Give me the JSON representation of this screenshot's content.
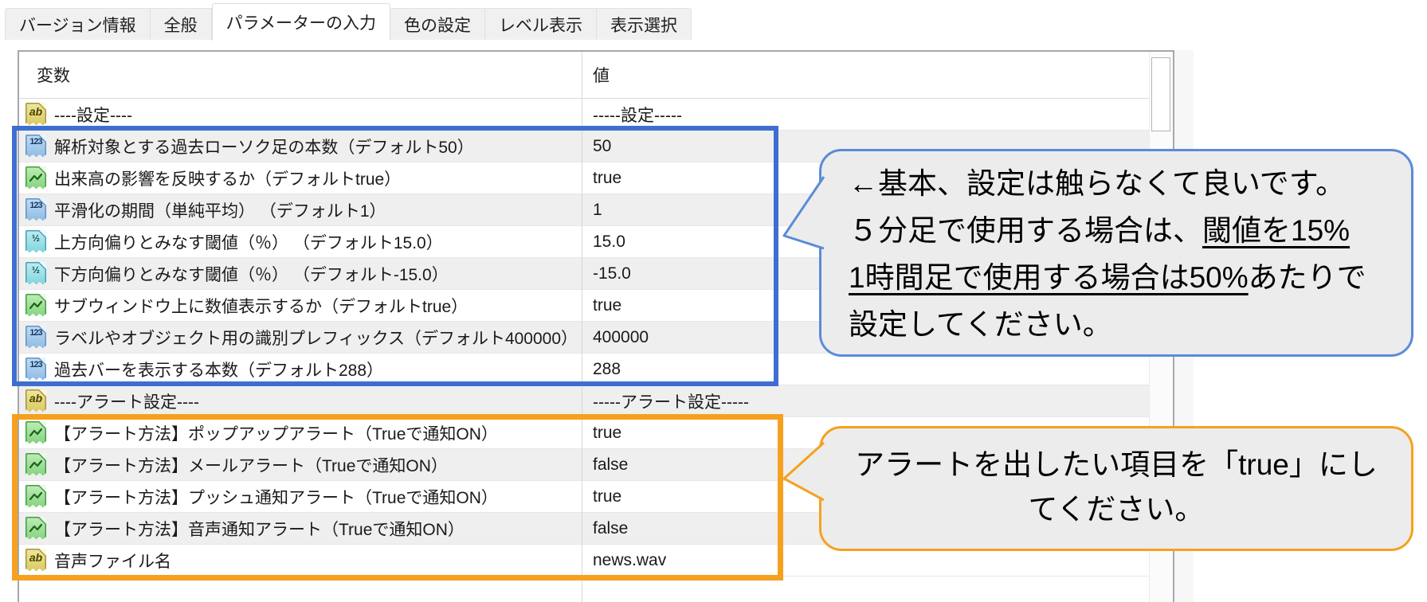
{
  "colors": {
    "blue_box": "#3e6fd0",
    "blue_bubble_border": "#5b8bd9",
    "orange_accent": "#f5a11f"
  },
  "tabs": {
    "items": [
      {
        "key": "version-info",
        "label": "バージョン情報",
        "active": false
      },
      {
        "key": "common",
        "label": "全般",
        "active": false
      },
      {
        "key": "inputs",
        "label": "パラメーターの入力",
        "active": true
      },
      {
        "key": "colors",
        "label": "色の設定",
        "active": false
      },
      {
        "key": "levels",
        "label": "レベル表示",
        "active": false
      },
      {
        "key": "visualization",
        "label": "表示選択",
        "active": false
      }
    ]
  },
  "table": {
    "columns": {
      "variable": "変数",
      "value": "値"
    },
    "rows": [
      {
        "icon": "string",
        "variable": "----設定----",
        "value": "-----設定-----"
      },
      {
        "icon": "int",
        "variable": "解析対象とする過去ローソク足の本数（デフォルト50）",
        "value": "50"
      },
      {
        "icon": "bool",
        "variable": "出来高の影響を反映するか（デフォルトtrue）",
        "value": "true"
      },
      {
        "icon": "int",
        "variable": "平滑化の期間（単純平均） （デフォルト1）",
        "value": "1"
      },
      {
        "icon": "double",
        "variable": "上方向偏りとみなす閾値（％） （デフォルト15.0）",
        "value": "15.0"
      },
      {
        "icon": "double",
        "variable": "下方向偏りとみなす閾値（％） （デフォルト-15.0）",
        "value": "-15.0"
      },
      {
        "icon": "bool",
        "variable": "サブウィンドウ上に数値表示するか（デフォルトtrue）",
        "value": "true"
      },
      {
        "icon": "int",
        "variable": "ラベルやオブジェクト用の識別プレフィックス（デフォルト400000）",
        "value": "400000"
      },
      {
        "icon": "int",
        "variable": "過去バーを表示する本数（デフォルト288）",
        "value": "288"
      },
      {
        "icon": "string",
        "variable": "----アラート設定----",
        "value": "-----アラート設定-----"
      },
      {
        "icon": "bool",
        "variable": "【アラート方法】ポップアップアラート（Trueで通知ON）",
        "value": "true"
      },
      {
        "icon": "bool",
        "variable": "【アラート方法】メールアラート（Trueで通知ON）",
        "value": "false"
      },
      {
        "icon": "bool",
        "variable": "【アラート方法】プッシュ通知アラート（Trueで通知ON）",
        "value": "true"
      },
      {
        "icon": "bool",
        "variable": "【アラート方法】音声通知アラート（Trueで通知ON）",
        "value": "false"
      },
      {
        "icon": "string",
        "variable": "音声ファイル名",
        "value": "news.wav"
      }
    ]
  },
  "icon_glyphs": {
    "string": "ab",
    "int": "123",
    "double": "½",
    "bool": ""
  },
  "callouts": {
    "blue": {
      "lines": [
        [
          {
            "t": "←基本、設定は触らなくて良いです。"
          }
        ],
        [
          {
            "t": "５分足で使用する場合は、"
          },
          {
            "t": "閾値を15%",
            "u": true
          }
        ],
        [
          {
            "t": "1時間足で使用する場合は50%",
            "u": true
          },
          {
            "t": "あたりで"
          }
        ],
        [
          {
            "t": "設定してください。"
          }
        ]
      ]
    },
    "orange": {
      "lines": [
        [
          {
            "t": "アラートを出したい項目を「true」にし"
          }
        ],
        [
          {
            "t": "てください。"
          }
        ]
      ]
    }
  }
}
